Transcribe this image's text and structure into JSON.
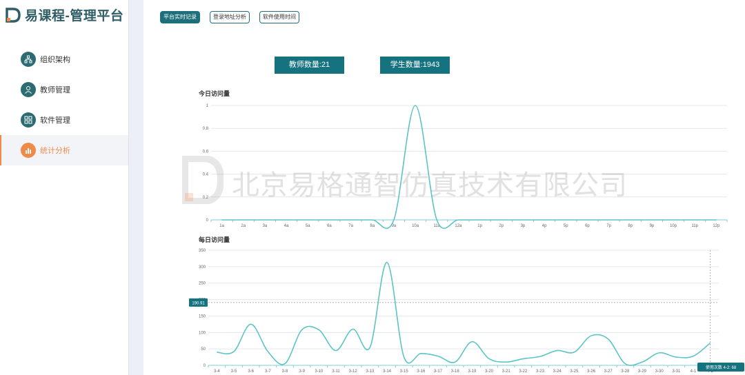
{
  "app": {
    "title": "易课程-管理平台"
  },
  "sidebar": {
    "items": [
      {
        "label": "组织架构",
        "icon": "org-chart-icon"
      },
      {
        "label": "教师管理",
        "icon": "teacher-icon"
      },
      {
        "label": "软件管理",
        "icon": "apps-grid-icon"
      },
      {
        "label": "统计分析",
        "icon": "bar-chart-icon",
        "active": true
      }
    ]
  },
  "tabs": [
    {
      "label": "平台实时记录",
      "active": true
    },
    {
      "label": "登录地址分析",
      "active": false
    },
    {
      "label": "软件使用时间",
      "active": false
    }
  ],
  "stats": {
    "teacher_count": "教师数量:21",
    "student_count": "学生数量:1943"
  },
  "watermark": {
    "text": "北京易格通智仿真技术有限公司"
  },
  "colors": {
    "accent": "#15727f",
    "active": "#f08a4b",
    "line": "#5cc3c6"
  },
  "chart_data": [
    {
      "type": "line",
      "title": "今日访问量",
      "categories": [
        "1a",
        "2a",
        "3a",
        "4a",
        "5a",
        "6a",
        "7a",
        "8a",
        "9a",
        "10a",
        "11a",
        "12a",
        "1p",
        "2p",
        "3p",
        "4p",
        "5p",
        "6p",
        "7p",
        "8p",
        "9p",
        "10p",
        "11p",
        "12p"
      ],
      "values": [
        0,
        0,
        0,
        0,
        0,
        0,
        0,
        0,
        0,
        1,
        0,
        0,
        0,
        0,
        0,
        0,
        0,
        0,
        0,
        0,
        0,
        0,
        0,
        0
      ],
      "yticks": [
        "0",
        "0.2",
        "0.4",
        "0.6",
        "0.8",
        "1"
      ],
      "ylim": [
        0,
        1
      ],
      "grid": true
    },
    {
      "type": "line",
      "title": "每日访问量",
      "categories": [
        "3-4",
        "3-5",
        "3-6",
        "3-7",
        "3-8",
        "3-9",
        "3-10",
        "3-11",
        "3-12",
        "3-13",
        "3-14",
        "3-15",
        "3-16",
        "3-17",
        "3-18",
        "3-19",
        "3-20",
        "3-21",
        "3-22",
        "3-23",
        "3-24",
        "3-25",
        "3-26",
        "3-27",
        "3-28",
        "3-29",
        "3-30",
        "3-31",
        "4-1",
        "4-2"
      ],
      "values": [
        40,
        42,
        125,
        42,
        5,
        108,
        108,
        45,
        110,
        55,
        313,
        25,
        36,
        28,
        10,
        72,
        20,
        10,
        20,
        27,
        45,
        40,
        90,
        80,
        5,
        10,
        38,
        25,
        28,
        68
      ],
      "yticks": [
        "0",
        "50",
        "100",
        "150",
        "200",
        "250",
        "300",
        "350"
      ],
      "ylim": [
        0,
        350
      ],
      "grid": true,
      "crosshair_value": "190.91",
      "tooltip": "使用次数 4-2: 68"
    }
  ]
}
